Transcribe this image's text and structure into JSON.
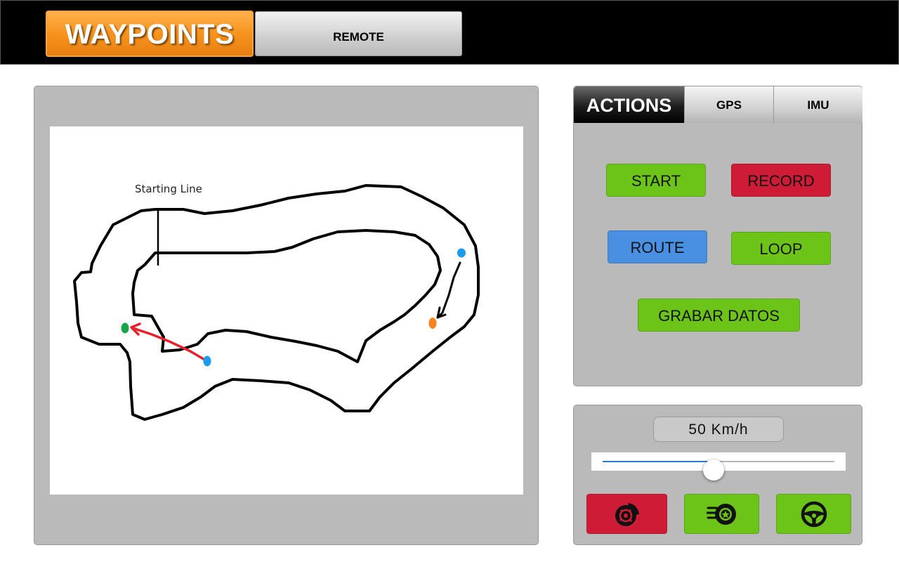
{
  "header": {
    "tabs": [
      {
        "label": "WAYPOINTS",
        "active": true
      },
      {
        "label": "REMOTE",
        "active": false
      }
    ]
  },
  "map": {
    "start_label": "Starting Line"
  },
  "actions_panel": {
    "tabs": [
      {
        "label": "ACTIONS",
        "active": true
      },
      {
        "label": "GPS",
        "active": false
      },
      {
        "label": "IMU",
        "active": false
      }
    ],
    "buttons": {
      "start": "START",
      "record": "RECORD",
      "route": "ROUTE",
      "loop": "LOOP",
      "grabar_datos": "GRABAR DATOS"
    }
  },
  "speed_panel": {
    "speed_text": "50 Km/h",
    "slider_fraction": 0.48,
    "icon_buttons": [
      {
        "icon": "brake-disc-icon",
        "color": "#cf1c36"
      },
      {
        "icon": "speeding-wheel-icon",
        "color": "#6cc419"
      },
      {
        "icon": "steering-wheel-icon",
        "color": "#6cc419"
      }
    ]
  },
  "colors": {
    "accent_orange": "#f7931e",
    "green": "#6cc419",
    "red": "#cf1c36",
    "blue": "#4a90e2",
    "panel_gray": "#bababa"
  }
}
